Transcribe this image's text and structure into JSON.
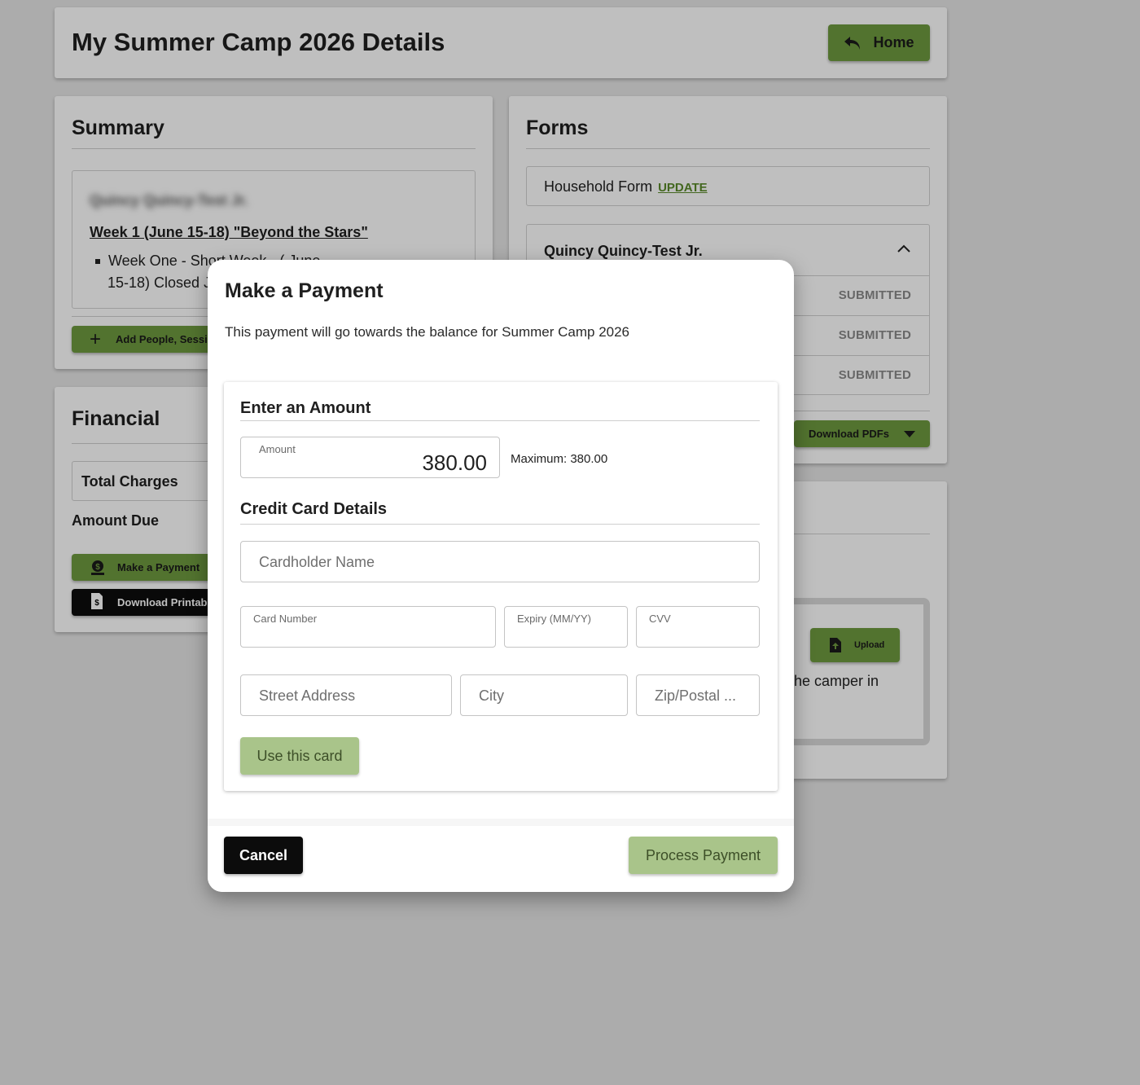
{
  "header": {
    "title": "My Summer Camp 2026 Details",
    "home_label": "Home"
  },
  "summary": {
    "title": "Summary",
    "camper_name_blurred": "Quincy Quincy-Test Jr.",
    "session_link": "Week 1 (June 15-18) \"Beyond the Stars\"",
    "session_detail_line1": "Week One - Short Week - ( June",
    "session_detail_line2": "15-18) Closed J",
    "add_button": "Add People, Sessio"
  },
  "financial": {
    "title": "Financial",
    "total_charges": "Total Charges",
    "amount_due": "Amount Due",
    "make_payment": "Make a Payment",
    "download_printable": "Download Printable"
  },
  "forms": {
    "title": "Forms",
    "household_form": "Household Form",
    "update_link": "UPDATE",
    "camper_name": "Quincy Quincy-Test Jr.",
    "statuses": [
      "SUBMITTED",
      "SUBMITTED",
      "SUBMITTED"
    ],
    "download_pdfs": "Download PDFs"
  },
  "documents": {
    "upload_label": "Upload",
    "partial_text": "he camper in"
  },
  "modal": {
    "title": "Make a Payment",
    "description": "This payment will go towards the balance for Summer Camp 2026",
    "amount_section": "Enter an Amount",
    "amount_label": "Amount",
    "amount_value": "380.00",
    "maximum_text": "Maximum: 380.00",
    "card_section": "Credit Card Details",
    "cardholder_placeholder": "Cardholder Name",
    "card_number_label": "Card Number",
    "expiry_label": "Expiry (MM/YY)",
    "cvv_label": "CVV",
    "street_placeholder": "Street Address",
    "city_placeholder": "City",
    "zip_placeholder": "Zip/Postal ...",
    "use_card_button": "Use this card",
    "cancel_button": "Cancel",
    "process_button": "Process Payment"
  },
  "colors": {
    "accent_green": "#6e9a3f",
    "disabled_green": "#a9c48a",
    "link_green": "#5a8a2a"
  }
}
